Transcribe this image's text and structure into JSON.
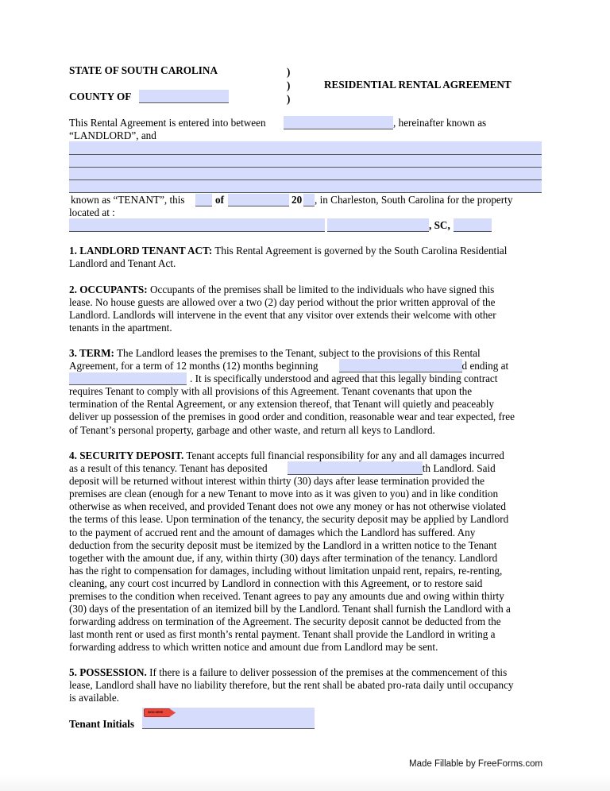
{
  "header": {
    "state": "STATE OF SOUTH CAROLINA",
    "county_label": "COUNTY OF",
    "parens": [
      ")",
      ")",
      ")"
    ],
    "title": "RESIDENTIAL RENTAL AGREEMENT"
  },
  "fields": {
    "county": "",
    "landlord_name": "",
    "tenant_line_1": "",
    "tenant_line_2": "",
    "tenant_line_3": "",
    "tenant_line_4": "",
    "day": "",
    "month": "",
    "year": "",
    "property_street": "",
    "property_city": "",
    "property_zip": "",
    "term_begin": "",
    "term_end": "",
    "deposit_amount": "",
    "tenant_initials": ""
  },
  "intro": {
    "line1_a": "This Rental Agreement is entered into between",
    "line1_b": ", hereinafter known as",
    "line2": "“LANDLORD”, and",
    "line3_a": "known as “TENANT”, this",
    "line3_of": "of",
    "line3_20": "20",
    "line3_b": ", in Charleston, South Carolina for  the property",
    "line4": "located at :",
    "sc": ", SC,"
  },
  "sections": {
    "s1": {
      "heading": "1. LANDLORD TENANT ACT:",
      "lines": [
        " This Rental Agreement is governed by the South Carolina Residential",
        "Landlord and Tenant Act."
      ]
    },
    "s2": {
      "heading": "2. OCCUPANTS:",
      "lines": [
        "  Occupants of the premises shall be limited to the individuals who have signed this",
        "lease.  No house guests are allowed over a two (2) day period without the prior written approval of the",
        "Landlord.  Landlords will intervene in the event that any visitor over extends their welcome with other",
        "tenants in the apartment."
      ]
    },
    "s3": {
      "heading": "3. TERM:",
      "line1": "  The Landlord leases the premises to the Tenant, subject to the provisions of this Rental",
      "line2_a": "Agreement, for a term of 12 months (12) months beginning",
      "line2_b": ", and ending at",
      "line3_b": ".  It is specifically understood and agreed that this legally binding contract",
      "lines": [
        "requires Tenant to comply with all provisions of this Agreement. Tenant covenants that upon the",
        "termination of the Rental Agreement, or any extension thereof, that Tenant will quietly and peaceably",
        "deliver up possession of the premises in good order and condition, reasonable wear and tear expected, free",
        "of Tenant’s personal property, garbage and other waste, and return all keys to Landlord."
      ]
    },
    "s4": {
      "heading": "4.  SECURITY DEPOSIT.",
      "line1": "  Tenant accepts full financial responsibility for any and all damages incurred",
      "line2_a": "as a result of this tenancy.  Tenant has deposited",
      "line2_b": "with Landlord.  Said",
      "lines": [
        "deposit will be returned without interest within thirty (30) days after lease termination provided the",
        "premises are clean (enough for a new Tenant to move into as it was given to you) and in like condition",
        "otherwise as when received, and provided Tenant does not owe any money or has not otherwise violated",
        "the terms of this lease.  Upon termination of the tenancy, the security deposit may be applied by Landlord",
        "to the payment of accrued rent and the amount of damages which the Landlord has suffered.  Any",
        "deduction from the security deposit must be itemized by the Landlord in a written notice to the Tenant",
        "together with the amount due, if any, within thirty (30) days after termination of the tenancy.  Landlord",
        "has the right to compensation for damages, including without limitation unpaid rent, repairs, re-renting,",
        "cleaning, any court cost incurred by Landlord in connection with this Agreement, or to restore said",
        "premises to the condition when received. Tenant agrees to pay any amounts due and owing within thirty",
        "(30) days of the presentation of an itemized bill by the Landlord.  Tenant shall furnish the Landlord with a",
        "forwarding address on termination of the Agreement.  The security deposit cannot be deducted from the",
        "last month rent or used as first month’s rental payment. Tenant shall provide the Landlord in writing a",
        "forwarding address to which written notice and amount due from Landlord may be sent."
      ]
    },
    "s5": {
      "heading": "5.  POSSESSION.",
      "lines": [
        "  If there is a failure to deliver possession of the premises at the commencement of this",
        "lease, Landlord shall have no liability therefore, but the rent shall be abated pro-rata daily until occupancy",
        "is available."
      ]
    }
  },
  "initials": {
    "label": "Tenant Initials",
    "flag_label": "SIGN HERE"
  },
  "footer": "Made Fillable by FreeForms.com",
  "colors": {
    "field_fill": "#d5dcfc",
    "flag": "#e8473c"
  }
}
